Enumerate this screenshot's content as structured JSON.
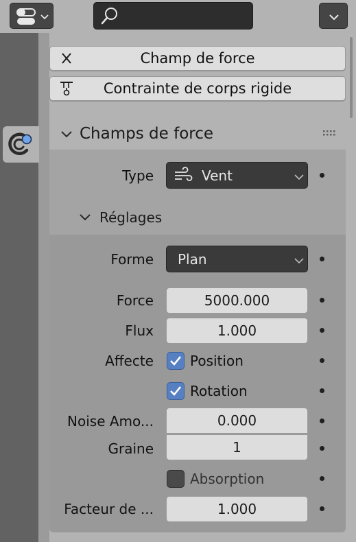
{
  "colors": {
    "accent": "#5680c2",
    "panel_bg": "#b3b3b3",
    "field_bg": "#dddddd",
    "dropdown_bg": "#3a3a3a"
  },
  "header": {
    "editor_type_icon": "properties-editor-icon",
    "search": {
      "placeholder": "",
      "value": ""
    },
    "options_icon": "chevron-down-icon"
  },
  "tabs": [
    {
      "name": "physics-tab",
      "icon": "physics-icon",
      "active": true
    }
  ],
  "add_buttons": [
    {
      "label": "Champ de force",
      "icon": "close-icon"
    },
    {
      "label": "Contrainte de corps rigide",
      "icon": "rigid-constraint-icon"
    }
  ],
  "force_field_panel": {
    "title": "Champs de force",
    "type": {
      "label": "Type",
      "value": "Vent",
      "icon": "wind-icon"
    },
    "settings": {
      "title": "Réglages",
      "shape": {
        "label": "Forme",
        "value": "Plan"
      },
      "strength": {
        "label": "Force",
        "value": "5000.000"
      },
      "flow": {
        "label": "Flux",
        "value": "1.000"
      },
      "affect": {
        "label": "Affecte",
        "location": {
          "label": "Position",
          "checked": true
        },
        "rotation": {
          "label": "Rotation",
          "checked": true
        }
      },
      "noise_amount": {
        "label": "Noise Amo...",
        "value": "0.000"
      },
      "seed": {
        "label": "Graine",
        "value": "1"
      },
      "absorption": {
        "label": "Absorption",
        "checked": false
      },
      "wind_factor": {
        "label": "Facteur de ...",
        "value": "1.000"
      }
    }
  }
}
